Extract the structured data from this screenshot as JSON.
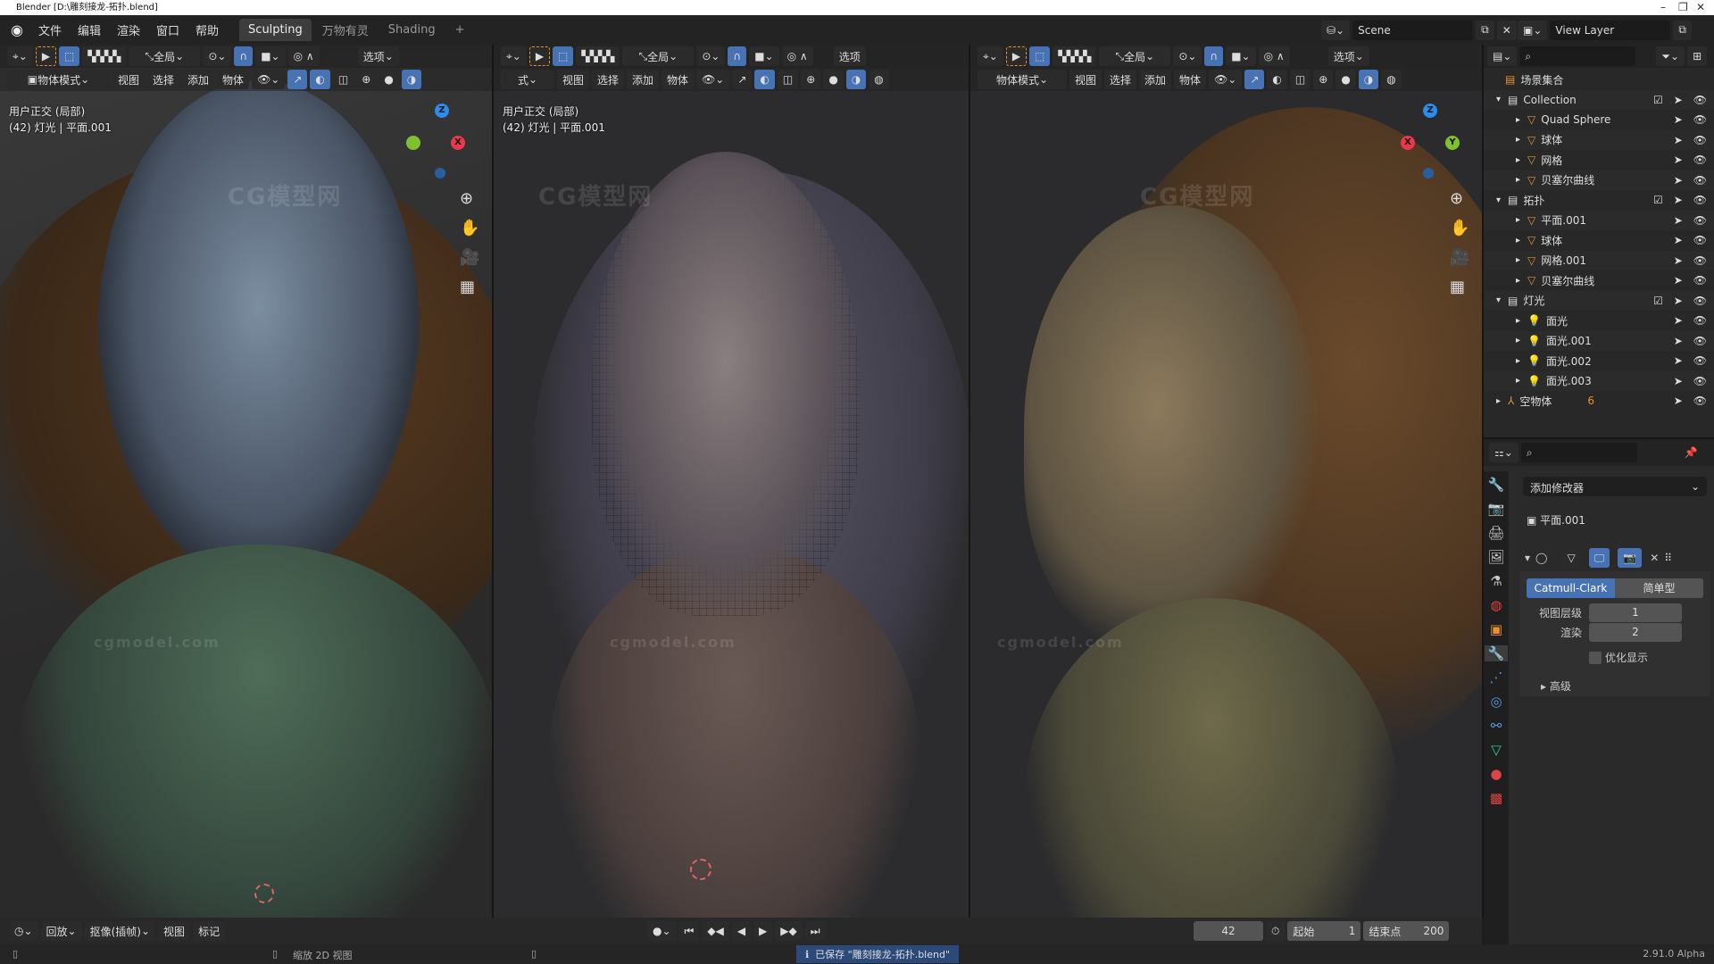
{
  "title": "Blender [D:\\雕刻接龙-拓扑.blend]",
  "menu": [
    "文件",
    "编辑",
    "渲染",
    "窗口",
    "帮助"
  ],
  "workspaces": [
    "Sculpting",
    "万物有灵",
    "Shading"
  ],
  "workspace_add": "+",
  "scene": "Scene",
  "view_layer": "View Layer",
  "viewport_header": {
    "transform_orientation": "全局",
    "options": "选项",
    "mode": "物体模式",
    "menus": [
      "视图",
      "选择",
      "添加",
      "物体"
    ],
    "mode_partial": "式"
  },
  "viewports": [
    {
      "view_name": "用户正交 (局部)",
      "info": "(42) 灯光 | 平面.001"
    },
    {
      "view_name": "用户正交 (局部)",
      "info": "(42) 灯光 | 平面.001"
    }
  ],
  "gizmo": {
    "z": "Z",
    "x": "X",
    "y": "Y"
  },
  "watermarks": [
    "cgmodel.com",
    "CG模型网"
  ],
  "outliner": {
    "root": "场景集合",
    "rows": [
      {
        "name": "Collection",
        "type": "collection",
        "depth": 1
      },
      {
        "name": "Quad Sphere",
        "type": "mesh",
        "depth": 2
      },
      {
        "name": "球体",
        "type": "mesh",
        "depth": 2
      },
      {
        "name": "网格",
        "type": "mesh",
        "depth": 2
      },
      {
        "name": "贝塞尔曲线",
        "type": "mesh",
        "depth": 2
      },
      {
        "name": "拓扑",
        "type": "collection",
        "depth": 1
      },
      {
        "name": "平面.001",
        "type": "mesh",
        "depth": 2
      },
      {
        "name": "球体",
        "type": "mesh",
        "depth": 2
      },
      {
        "name": "网格.001",
        "type": "mesh",
        "depth": 2
      },
      {
        "name": "贝塞尔曲线",
        "type": "mesh",
        "depth": 2
      },
      {
        "name": "灯光",
        "type": "collection",
        "depth": 1
      },
      {
        "name": "面光",
        "type": "light",
        "depth": 2
      },
      {
        "name": "面光.001",
        "type": "light",
        "depth": 2
      },
      {
        "name": "面光.002",
        "type": "light",
        "depth": 2
      },
      {
        "name": "面光.003",
        "type": "light",
        "depth": 2
      },
      {
        "name": "空物体",
        "type": "empty",
        "depth": 1
      }
    ],
    "empty_children": "6"
  },
  "properties": {
    "add_modifier": "添加修改器",
    "object": "平面.001",
    "subdiv_types": [
      "Catmull-Clark",
      "简单型"
    ],
    "levels_viewport_label": "视图层级",
    "levels_viewport": "1",
    "render_label": "渲染",
    "render": "2",
    "optimal_display": "优化显示",
    "optimal_display_checked": false,
    "advanced": "高级"
  },
  "timeline": {
    "playback": "回放",
    "keying": "抠像(插帧)",
    "view": "视图",
    "marker": "标记",
    "current_frame": "42",
    "start_label": "起始",
    "start": "1",
    "end_label": "结束点",
    "end": "200"
  },
  "status": {
    "hint": "缩放 2D 视图",
    "message": "已保存 \"雕刻接龙-拓扑.blend\"",
    "version": "2.91.0 Alpha"
  },
  "colors": {
    "accent": "#4772b3",
    "bg": "#1d1d1d",
    "orange": "#e8922f"
  }
}
